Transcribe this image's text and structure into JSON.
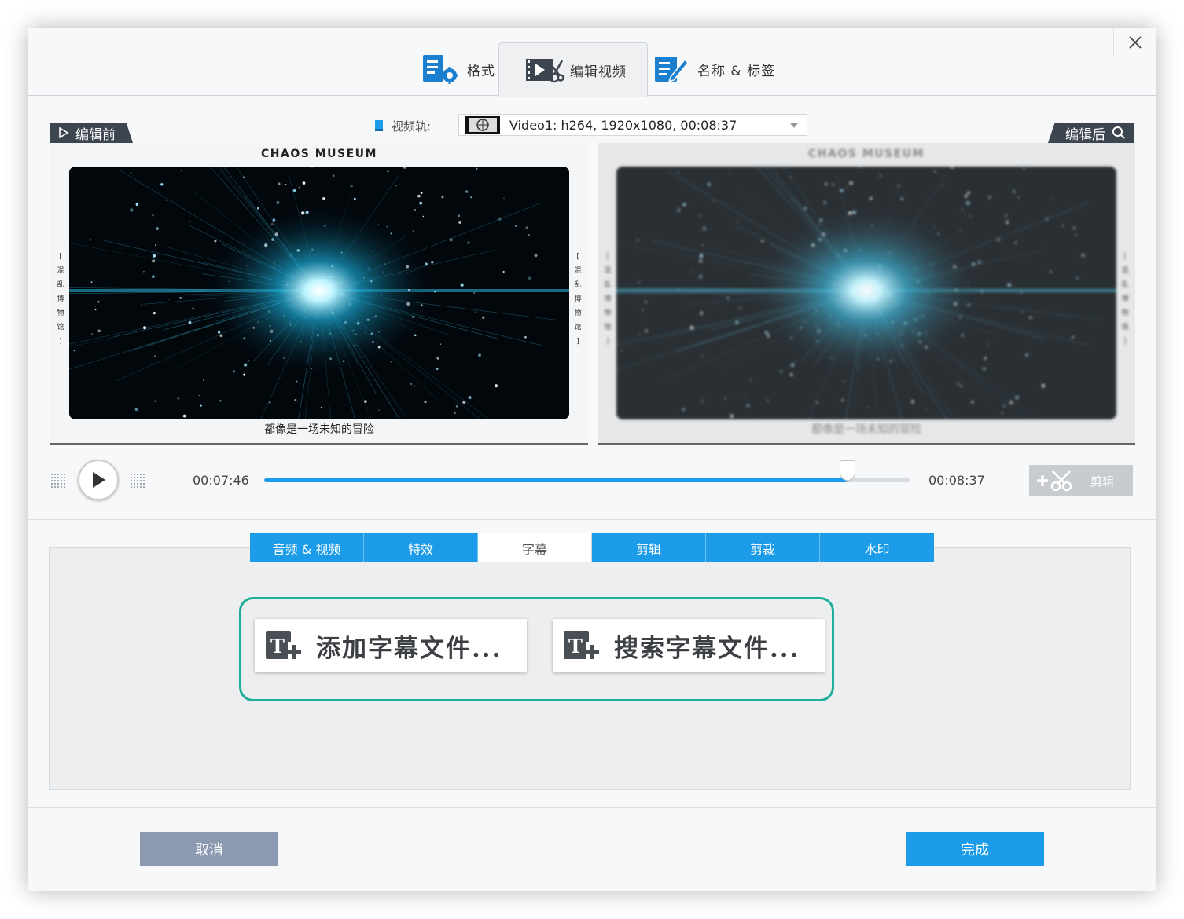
{
  "top_tabs": [
    {
      "label": "格式",
      "icon": "format-settings-icon"
    },
    {
      "label": "编辑视频",
      "icon": "video-edit-icon"
    },
    {
      "label": "名称 & 标签",
      "icon": "name-tag-icon"
    }
  ],
  "active_top_tab": "编辑视频",
  "video_track": {
    "label": "视频轨:",
    "selected": "Video1: h264, 1920x1080, 00:08:37"
  },
  "preview": {
    "before_label": "编辑前",
    "after_label": "编辑后",
    "video_title": "CHAOS MUSEUM",
    "video_caption": "都像是一场未知的冒险",
    "side_text": [
      "[",
      "混",
      "乱",
      "博",
      "物",
      "馆",
      "]"
    ]
  },
  "playback": {
    "current_time": "00:07:46",
    "total_time": "00:08:37",
    "progress": 0.903,
    "trim_label": "剪辑"
  },
  "sub_tabs": [
    {
      "label": "音频 & 视频"
    },
    {
      "label": "特效"
    },
    {
      "label": "字幕"
    },
    {
      "label": "剪辑"
    },
    {
      "label": "剪裁"
    },
    {
      "label": "水印"
    }
  ],
  "active_sub_tab": "字幕",
  "subtitle_actions": {
    "add": "添加字幕文件...",
    "search": "搜索字幕文件..."
  },
  "footer": {
    "cancel": "取消",
    "done": "完成"
  },
  "colors": {
    "accent": "#1b9be8",
    "highlight": "#1fae9a",
    "tag_bg": "#3d4550",
    "cancel_bg": "#8b9ab0"
  }
}
